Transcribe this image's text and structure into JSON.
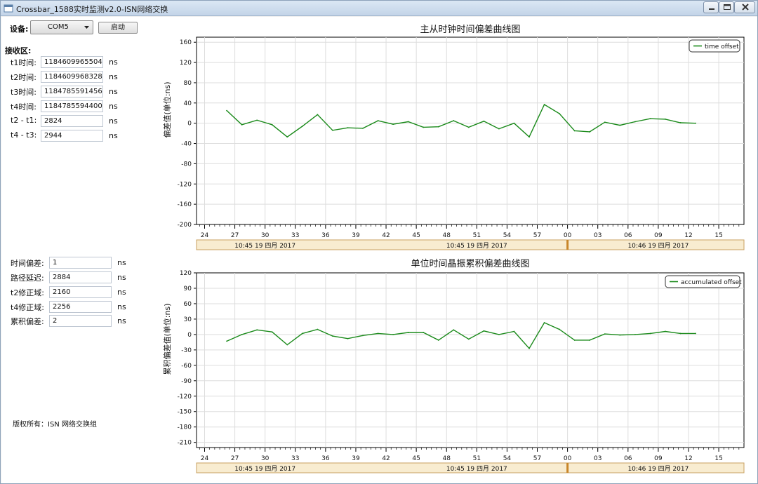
{
  "window": {
    "title": "Crossbar_1588实时监测v2.0-ISN网络交换"
  },
  "toolbar": {
    "device_label": "设备:",
    "device_value": "COM5",
    "start_label": "启动"
  },
  "receive": {
    "section_label": "接收区:",
    "rows": [
      {
        "label": "t1时间:",
        "value": "1184609965504",
        "unit": "ns"
      },
      {
        "label": "t2时间:",
        "value": "1184609968328",
        "unit": "ns"
      },
      {
        "label": "t3时间:",
        "value": "1184785591456",
        "unit": "ns"
      },
      {
        "label": "t4时间:",
        "value": "1184785594400",
        "unit": "ns"
      },
      {
        "label": "t2 - t1:",
        "value": "2824",
        "unit": "ns"
      },
      {
        "label": "t4 - t3:",
        "value": "2944",
        "unit": "ns"
      }
    ]
  },
  "results": {
    "rows": [
      {
        "label": "时间偏差:",
        "value": "1",
        "unit": "ns"
      },
      {
        "label": "路径延迟:",
        "value": "2884",
        "unit": "ns"
      },
      {
        "label": "t2修正域:",
        "value": "2160",
        "unit": "ns"
      },
      {
        "label": "t4修正域:",
        "value": "2256",
        "unit": "ns"
      },
      {
        "label": "累积偏差:",
        "value": "2",
        "unit": "ns"
      }
    ]
  },
  "footer": {
    "copyright": "版权所有：ISN 网络交换组"
  },
  "chart_data": [
    {
      "type": "line",
      "title": "主从时钟时间偏差曲线图",
      "xlabel": "",
      "ylabel": "偏差值(单位:ns)",
      "ylim": [
        -200,
        170
      ],
      "yticks": [
        "160",
        "120",
        "80",
        "40",
        "0",
        "-40",
        "-80",
        "-120",
        "-160",
        "-200"
      ],
      "xticks": [
        "24",
        "27",
        "30",
        "33",
        "36",
        "39",
        "42",
        "45",
        "48",
        "51",
        "54",
        "57",
        "00",
        "03",
        "06",
        "09",
        "12",
        "15"
      ],
      "time_axis": [
        "10:45 19 四月 2017",
        "10:45 19 四月 2017",
        "10:46 19 四月 2017"
      ],
      "grid": true,
      "legend_position": "top-right",
      "series_color": "#1a8a1a",
      "series": [
        {
          "name": "time offset",
          "x": [
            26.2,
            27.7,
            29.2,
            30.7,
            32.2,
            33.7,
            35.2,
            36.7,
            38.2,
            39.7,
            41.2,
            42.7,
            44.2,
            45.7,
            47.2,
            48.7,
            50.2,
            51.7,
            53.2,
            54.7,
            56.2,
            57.7,
            59.2,
            60.7,
            62.2,
            63.7,
            65.2,
            66.7,
            68.2,
            69.7,
            71.2,
            72.7
          ],
          "values": [
            25,
            -3,
            6,
            -3,
            -27,
            -6,
            17,
            -14,
            -9,
            -10,
            5,
            -2,
            3,
            -8,
            -7,
            5,
            -8,
            4,
            -11,
            0,
            -27,
            37,
            19,
            -15,
            -17,
            2,
            -4,
            3,
            9,
            8,
            1,
            0
          ]
        }
      ]
    },
    {
      "type": "line",
      "title": "单位时间晶振累积偏差曲线图",
      "xlabel": "",
      "ylabel": "累积偏差值(单位:ns)",
      "ylim": [
        -220,
        120
      ],
      "yticks": [
        "120",
        "90",
        "60",
        "30",
        "0",
        "-30",
        "-60",
        "-90",
        "-120",
        "-150",
        "-180",
        "-210"
      ],
      "xticks": [
        "24",
        "27",
        "30",
        "33",
        "36",
        "39",
        "42",
        "45",
        "48",
        "51",
        "54",
        "57",
        "00",
        "03",
        "06",
        "09",
        "12",
        "15"
      ],
      "time_axis": [
        "10:45 19 四月 2017",
        "10:45 19 四月 2017",
        "10:46 19 四月 2017"
      ],
      "grid": true,
      "legend_position": "top-right",
      "series_color": "#1a8a1a",
      "series": [
        {
          "name": "accumulated offset",
          "x": [
            26.2,
            27.7,
            29.2,
            30.7,
            32.2,
            33.7,
            35.2,
            36.7,
            38.2,
            39.7,
            41.2,
            42.7,
            44.2,
            45.7,
            47.2,
            48.7,
            50.2,
            51.7,
            53.2,
            54.7,
            56.2,
            57.7,
            59.2,
            60.7,
            62.2,
            63.7,
            65.2,
            66.7,
            68.2,
            69.7,
            71.2,
            72.7
          ],
          "values": [
            -13,
            0,
            9,
            5,
            -20,
            2,
            10,
            -3,
            -8,
            -2,
            2,
            0,
            4,
            4,
            -11,
            9,
            -9,
            7,
            0,
            6,
            -27,
            23,
            10,
            -11,
            -11,
            1,
            -1,
            0,
            2,
            6,
            2,
            2
          ]
        }
      ]
    }
  ]
}
